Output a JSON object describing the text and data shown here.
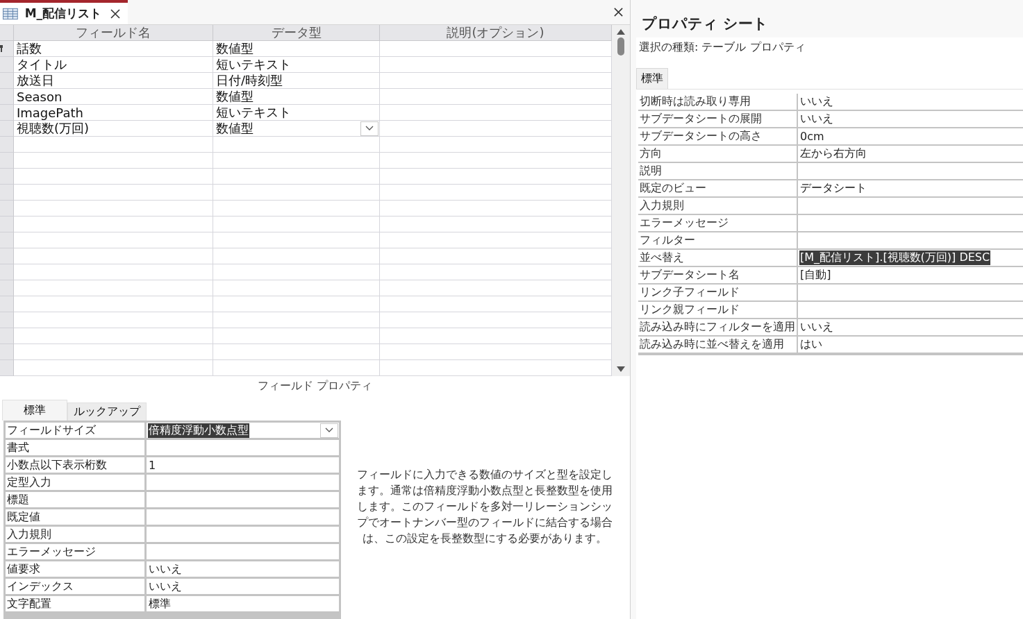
{
  "tab": {
    "title": "M_配信リスト"
  },
  "design_grid": {
    "columns": [
      "フィールド名",
      "データ型",
      "説明(オプション)"
    ],
    "rows": [
      {
        "name": "話数",
        "type": "数値型",
        "primary_key": true,
        "focused": false
      },
      {
        "name": "タイトル",
        "type": "短いテキスト",
        "primary_key": false,
        "focused": false
      },
      {
        "name": "放送日",
        "type": "日付/時刻型",
        "primary_key": false,
        "focused": false
      },
      {
        "name": "Season",
        "type": "数値型",
        "primary_key": false,
        "focused": false
      },
      {
        "name": "ImagePath",
        "type": "短いテキスト",
        "primary_key": false,
        "focused": false
      },
      {
        "name": "視聴数(万回)",
        "type": "数値型",
        "primary_key": false,
        "focused": true
      }
    ]
  },
  "field_properties": {
    "title": "フィールド プロパティ",
    "tabs": [
      {
        "label": "標準",
        "selected": true
      },
      {
        "label": "ルックアップ",
        "selected": false
      }
    ],
    "rows": [
      {
        "label": "フィールドサイズ",
        "value": "倍精度浮動小数点型",
        "highlighted": true,
        "dropdown": true
      },
      {
        "label": "書式",
        "highlighted": false,
        "dropdown": false
      },
      {
        "label": "小数点以下表示桁数",
        "value": "1",
        "highlighted": false,
        "dropdown": false
      },
      {
        "label": "定型入力",
        "highlighted": false,
        "dropdown": false
      },
      {
        "label": "標題",
        "highlighted": false,
        "dropdown": false
      },
      {
        "label": "既定値",
        "highlighted": false,
        "dropdown": false
      },
      {
        "label": "入力規則",
        "highlighted": false,
        "dropdown": false
      },
      {
        "label": "エラーメッセージ",
        "highlighted": false,
        "dropdown": false
      },
      {
        "label": "値要求",
        "value": "いいえ",
        "highlighted": false,
        "dropdown": false
      },
      {
        "label": "インデックス",
        "value": "いいえ",
        "highlighted": false,
        "dropdown": false
      },
      {
        "label": "文字配置",
        "value": "標準",
        "highlighted": false,
        "dropdown": false
      }
    ],
    "help": "フィールドに入力できる数値のサイズと型を設定します。通常は倍精度浮動小数点型と長整数型を使用します。このフィールドを多対一リレーションシップでオートナンバー型のフィールドに結合する場合は、この設定を長整数型にする必要があります。"
  },
  "property_sheet": {
    "title": "プロパティ シート",
    "selection_type": "選択の種類: テーブル プロパティ",
    "tabs": [
      {
        "label": "標準",
        "selected": true
      }
    ],
    "rows": [
      {
        "label": "切断時は読み取り専用",
        "value": "いいえ",
        "highlighted": false
      },
      {
        "label": "サブデータシートの展開",
        "value": "いいえ",
        "highlighted": false
      },
      {
        "label": "サブデータシートの高さ",
        "value": "0cm",
        "highlighted": false
      },
      {
        "label": "方向",
        "value": "左から右方向",
        "highlighted": false
      },
      {
        "label": "説明",
        "highlighted": false
      },
      {
        "label": "既定のビュー",
        "value": "データシート",
        "highlighted": false
      },
      {
        "label": "入力規則",
        "highlighted": false
      },
      {
        "label": "エラーメッセージ",
        "highlighted": false
      },
      {
        "label": "フィルター",
        "highlighted": false
      },
      {
        "label": "並べ替え",
        "value": "[M_配信リスト].[視聴数(万回)] DESC",
        "highlighted": true
      },
      {
        "label": "サブデータシート名",
        "value": "[自動]",
        "highlighted": false
      },
      {
        "label": "リンク子フィールド",
        "highlighted": false
      },
      {
        "label": "リンク親フィールド",
        "highlighted": false
      },
      {
        "label": "読み込み時にフィルターを適用",
        "value": "いいえ",
        "highlighted": false
      },
      {
        "label": "読み込み時に並べ替えを適用",
        "value": "はい",
        "highlighted": false
      }
    ]
  }
}
